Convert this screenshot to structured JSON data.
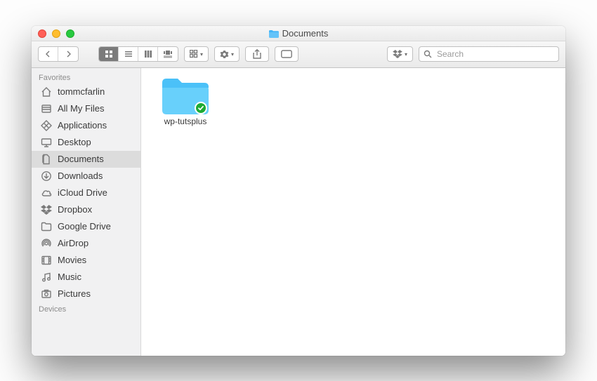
{
  "window": {
    "title": "Documents"
  },
  "toolbar": {
    "search_placeholder": "Search"
  },
  "sidebar": {
    "sections": [
      {
        "label": "Favorites",
        "items": [
          {
            "icon": "home",
            "label": "tommcfarlin",
            "selected": false
          },
          {
            "icon": "allmyfiles",
            "label": "All My Files",
            "selected": false
          },
          {
            "icon": "apps",
            "label": "Applications",
            "selected": false
          },
          {
            "icon": "desktop",
            "label": "Desktop",
            "selected": false
          },
          {
            "icon": "documents",
            "label": "Documents",
            "selected": true
          },
          {
            "icon": "downloads",
            "label": "Downloads",
            "selected": false
          },
          {
            "icon": "icloud",
            "label": "iCloud Drive",
            "selected": false
          },
          {
            "icon": "dropbox",
            "label": "Dropbox",
            "selected": false
          },
          {
            "icon": "folder",
            "label": "Google Drive",
            "selected": false
          },
          {
            "icon": "airdrop",
            "label": "AirDrop",
            "selected": false
          },
          {
            "icon": "movies",
            "label": "Movies",
            "selected": false
          },
          {
            "icon": "music",
            "label": "Music",
            "selected": false
          },
          {
            "icon": "pictures",
            "label": "Pictures",
            "selected": false
          }
        ]
      },
      {
        "label": "Devices",
        "items": []
      }
    ]
  },
  "content": {
    "items": [
      {
        "name": "wp-tutsplus",
        "type": "folder",
        "synced": true
      }
    ]
  }
}
